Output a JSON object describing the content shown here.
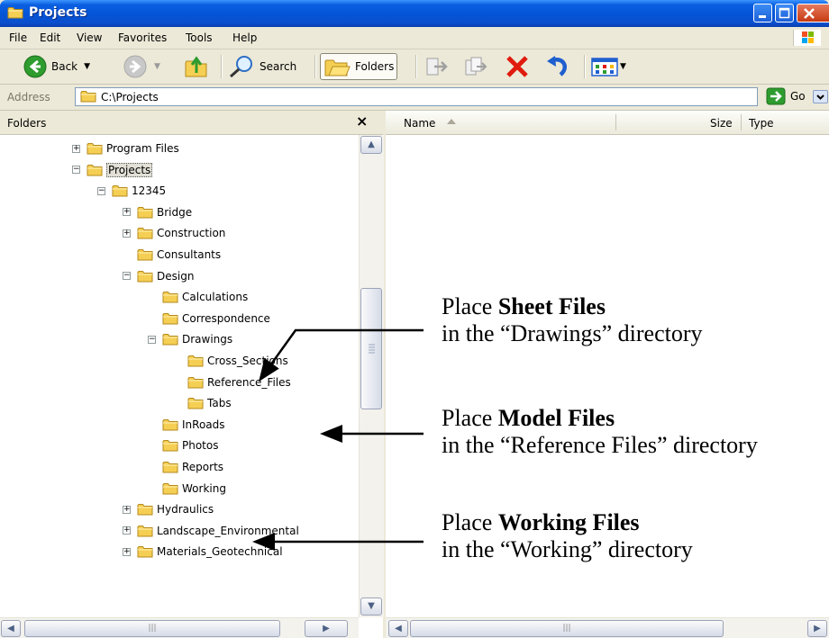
{
  "window": {
    "title": "Projects"
  },
  "menu": [
    "File",
    "Edit",
    "View",
    "Favorites",
    "Tools",
    "Help"
  ],
  "toolbar": {
    "back": "Back",
    "search": "Search",
    "folders": "Folders"
  },
  "address": {
    "label": "Address",
    "value": "C:\\Projects",
    "go": "Go"
  },
  "folders_pane": {
    "title": "Folders",
    "close": "×"
  },
  "tree": [
    {
      "label": "Program Files",
      "depth": 0,
      "expander": "+"
    },
    {
      "label": "Projects",
      "depth": 0,
      "expander": "−",
      "selected": true
    },
    {
      "label": "12345",
      "depth": 1,
      "expander": "−"
    },
    {
      "label": "Bridge",
      "depth": 2,
      "expander": "+"
    },
    {
      "label": "Construction",
      "depth": 2,
      "expander": "+"
    },
    {
      "label": "Consultants",
      "depth": 2,
      "expander": ""
    },
    {
      "label": "Design",
      "depth": 2,
      "expander": "−"
    },
    {
      "label": "Calculations",
      "depth": 3,
      "expander": ""
    },
    {
      "label": "Correspondence",
      "depth": 3,
      "expander": ""
    },
    {
      "label": "Drawings",
      "depth": 3,
      "expander": "−"
    },
    {
      "label": "Cross_Sections",
      "depth": 4,
      "expander": ""
    },
    {
      "label": "Reference_Files",
      "depth": 4,
      "expander": ""
    },
    {
      "label": "Tabs",
      "depth": 4,
      "expander": ""
    },
    {
      "label": "InRoads",
      "depth": 3,
      "expander": ""
    },
    {
      "label": "Photos",
      "depth": 3,
      "expander": ""
    },
    {
      "label": "Reports",
      "depth": 3,
      "expander": ""
    },
    {
      "label": "Working",
      "depth": 3,
      "expander": ""
    },
    {
      "label": "Hydraulics",
      "depth": 2,
      "expander": "+"
    },
    {
      "label": "Landscape_Environmental",
      "depth": 2,
      "expander": "+"
    },
    {
      "label": "Materials_Geotechnical",
      "depth": 2,
      "expander": "+"
    }
  ],
  "columns": {
    "name": "Name",
    "size": "Size",
    "type": "Type"
  },
  "annotations": {
    "sheet": {
      "pre": "Place ",
      "bold": "Sheet Files",
      "line2": "in the “Drawings” directory"
    },
    "model": {
      "pre": "Place ",
      "bold": "Model Files",
      "line2": "in the “Reference Files” directory"
    },
    "working": {
      "pre": "Place ",
      "bold": "Working Files",
      "line2": "in the “Working” directory"
    }
  },
  "icons": {
    "folder": "folder-icon",
    "back": "back-arrow-icon",
    "forward": "forward-arrow-icon",
    "up": "up-folder-icon",
    "search": "search-icon",
    "move": "move-to-icon",
    "copy": "copy-to-icon",
    "delete": "delete-icon",
    "undo": "undo-icon",
    "views": "views-icon",
    "go": "go-arrow-icon"
  },
  "colors": {
    "titlebar": "#0454d6",
    "folder": "#f5cf54",
    "delete": "#e01b0e",
    "back": "#2e9c2e"
  }
}
